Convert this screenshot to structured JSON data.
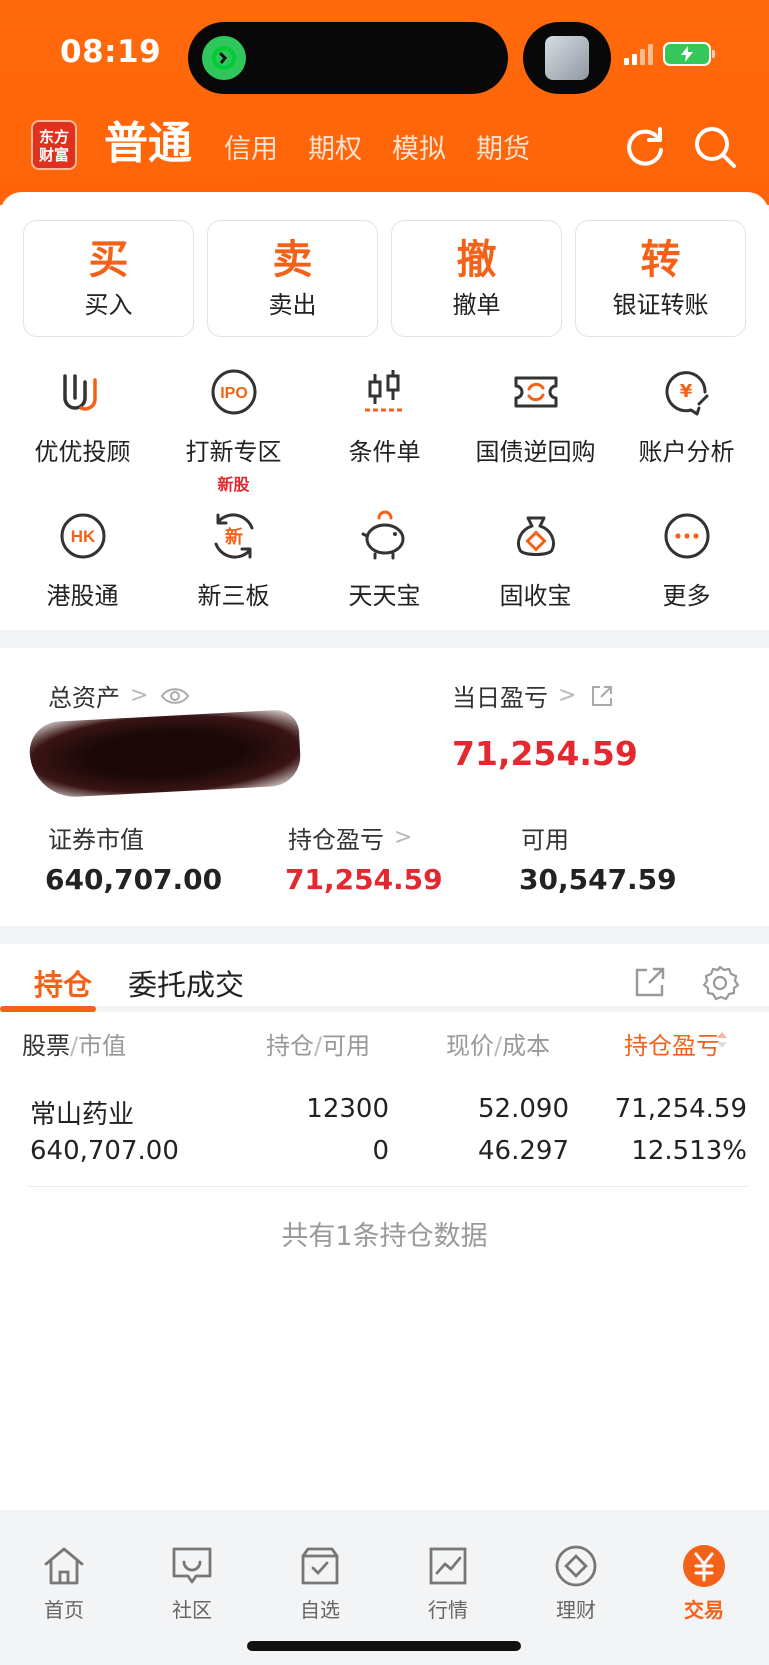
{
  "status": {
    "time": "08:19"
  },
  "header": {
    "logo": [
      "东方",
      "财富"
    ],
    "tabs": [
      {
        "label": "普通",
        "active": true
      },
      {
        "label": "信用"
      },
      {
        "label": "期权"
      },
      {
        "label": "模拟"
      },
      {
        "label": "期货"
      }
    ],
    "icons": [
      "refresh-icon",
      "search-icon"
    ]
  },
  "actions": [
    {
      "big": "买",
      "small": "买入"
    },
    {
      "big": "卖",
      "small": "卖出"
    },
    {
      "big": "撤",
      "small": "撤单"
    },
    {
      "big": "转",
      "small": "银证转账"
    }
  ],
  "grid": [
    {
      "icon": "youyou-icon",
      "label": "优优投顾"
    },
    {
      "icon": "ipo-icon",
      "label": "打新专区",
      "badge": "新股"
    },
    {
      "icon": "candlestick-icon",
      "label": "条件单"
    },
    {
      "icon": "repo-icon",
      "label": "国债逆回购"
    },
    {
      "icon": "analysis-icon",
      "label": "账户分析"
    },
    {
      "icon": "hk-icon",
      "label": "港股通"
    },
    {
      "icon": "new-board-icon",
      "label": "新三板"
    },
    {
      "icon": "piggy-icon",
      "label": "天天宝"
    },
    {
      "icon": "money-bag-icon",
      "label": "固收宝"
    },
    {
      "icon": "more-icon",
      "label": "更多"
    }
  ],
  "assets": {
    "total_label": "总资产",
    "daily_pnl_label": "当日盈亏",
    "daily_pnl_value": "71,254.59",
    "market_value_label": "证券市值",
    "market_value": "640,707.00",
    "position_pnl_label": "持仓盈亏",
    "position_pnl": "71,254.59",
    "available_label": "可用",
    "available": "30,547.59"
  },
  "holdings": {
    "tabs": [
      {
        "label": "持仓",
        "active": true
      },
      {
        "label": "委托成交"
      }
    ],
    "columns": [
      {
        "a": "股票",
        "b": "市值"
      },
      {
        "a": "持仓",
        "b": "可用"
      },
      {
        "a": "现价",
        "b": "成本"
      },
      {
        "a": "持仓盈亏"
      }
    ],
    "rows": [
      {
        "name": "常山药业",
        "market_value": "640,707.00",
        "position": "12300",
        "available": "0",
        "price": "52.090",
        "cost": "46.297",
        "pnl": "71,254.59",
        "pnl_pct": "12.513%"
      }
    ],
    "summary": "共有1条持仓数据"
  },
  "nav": [
    {
      "icon": "home-icon",
      "label": "首页"
    },
    {
      "icon": "community-icon",
      "label": "社区"
    },
    {
      "icon": "watchlist-icon",
      "label": "自选"
    },
    {
      "icon": "market-icon",
      "label": "行情"
    },
    {
      "icon": "finance-icon",
      "label": "理财"
    },
    {
      "icon": "trade-icon",
      "label": "交易",
      "active": true
    }
  ],
  "colors": {
    "accent": "#f4621a",
    "header": "#ff6a0c",
    "up": "#e3282f"
  }
}
